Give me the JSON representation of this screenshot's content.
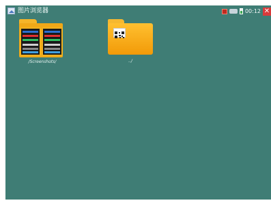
{
  "window": {
    "title": "图片浏览器"
  },
  "status_bar": {
    "time": "00:12",
    "close_label": "✕",
    "icons": [
      "red-indicator-icon",
      "plug-icon",
      "battery-icon"
    ]
  },
  "items": [
    {
      "label": "/Screenshots/",
      "kind": "folder-with-thumbnails"
    },
    {
      "label": "../",
      "kind": "parent-folder"
    }
  ],
  "colors": {
    "background": "#3f7d75",
    "folder": "#f0a818",
    "close_button": "#d93b3b"
  }
}
